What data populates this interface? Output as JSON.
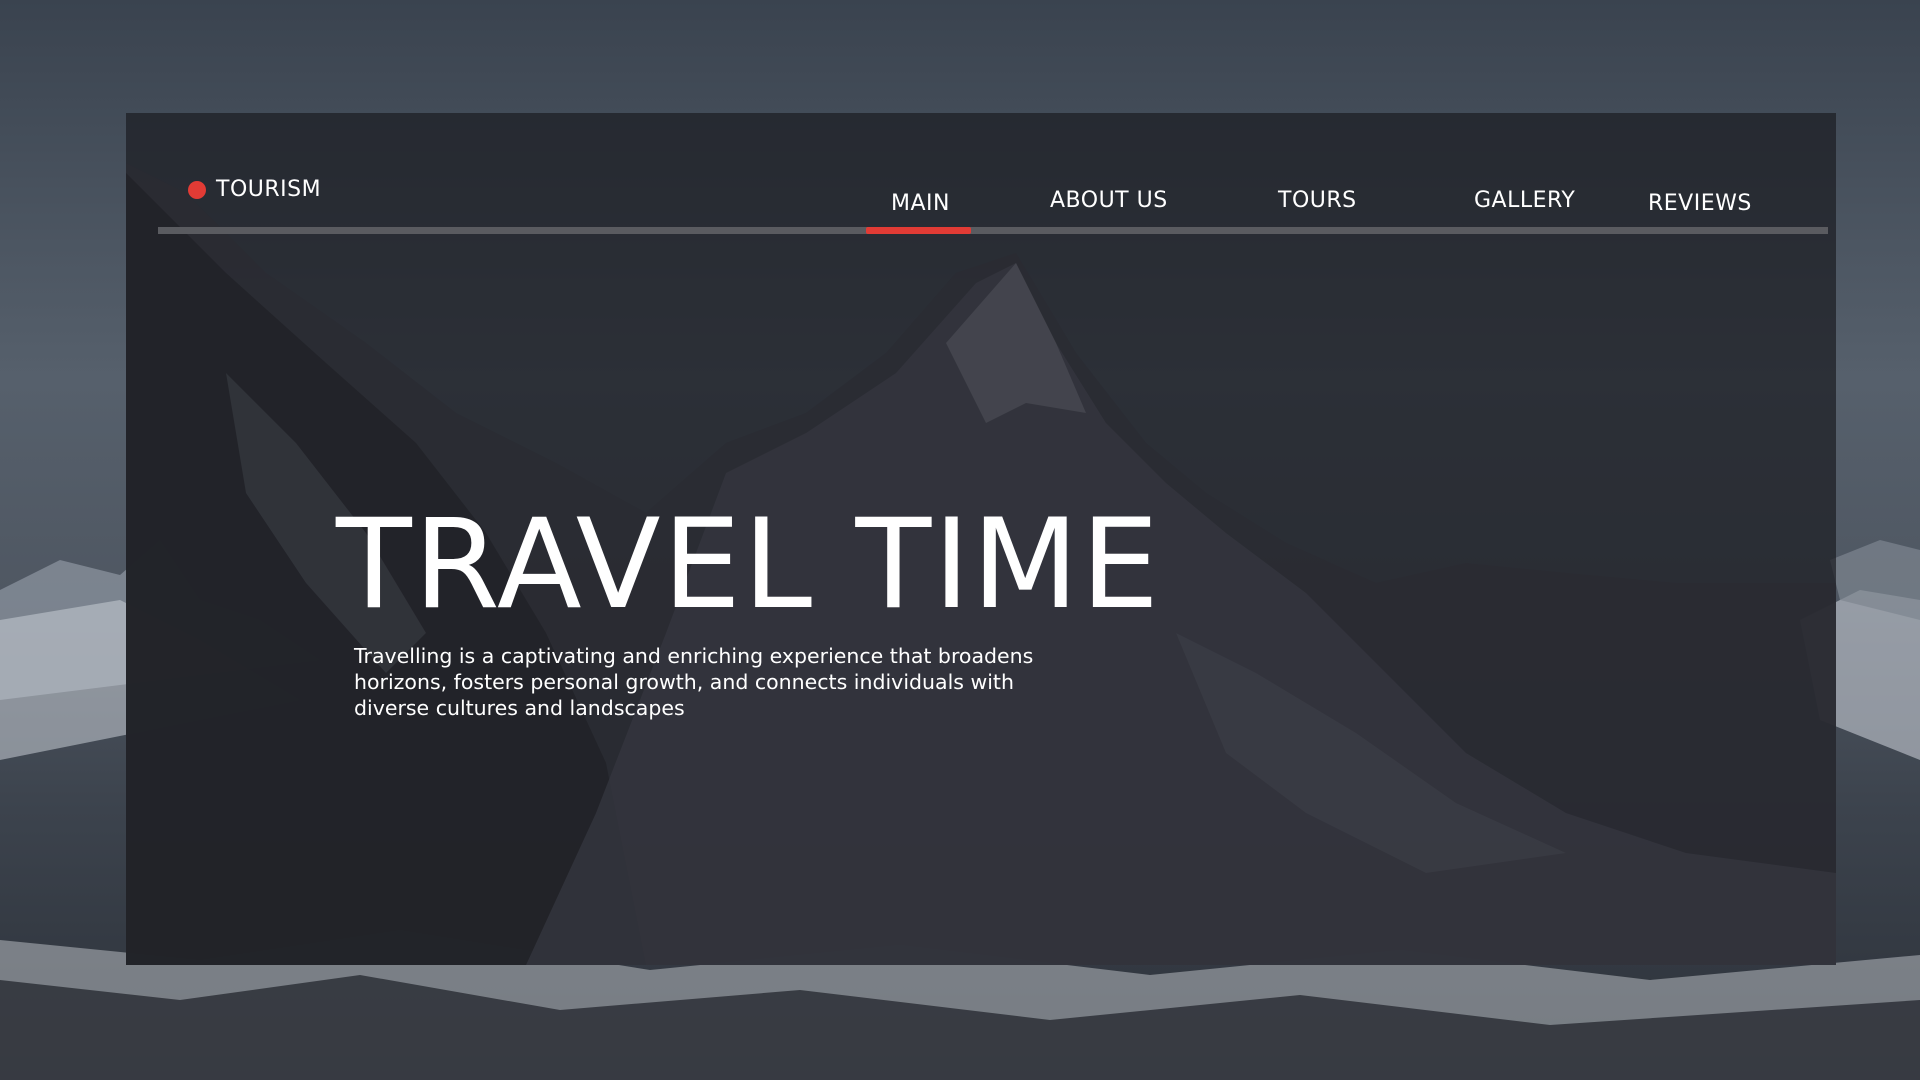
{
  "brand": {
    "name": "TOURISM",
    "accent_color": "#e23b35"
  },
  "nav": {
    "items": [
      {
        "label": "MAIN",
        "active": true
      },
      {
        "label": "ABOUT US",
        "active": false
      },
      {
        "label": "TOURS",
        "active": false
      },
      {
        "label": "GALLERY",
        "active": false
      },
      {
        "label": "REVIEWS",
        "active": false
      }
    ]
  },
  "hero": {
    "title": "TRAVEL TIME",
    "description": "Travelling is a captivating and enriching experience that broadens\n horizons, fosters personal growth, and connects individuals with\ndiverse cultures and landscapes"
  }
}
